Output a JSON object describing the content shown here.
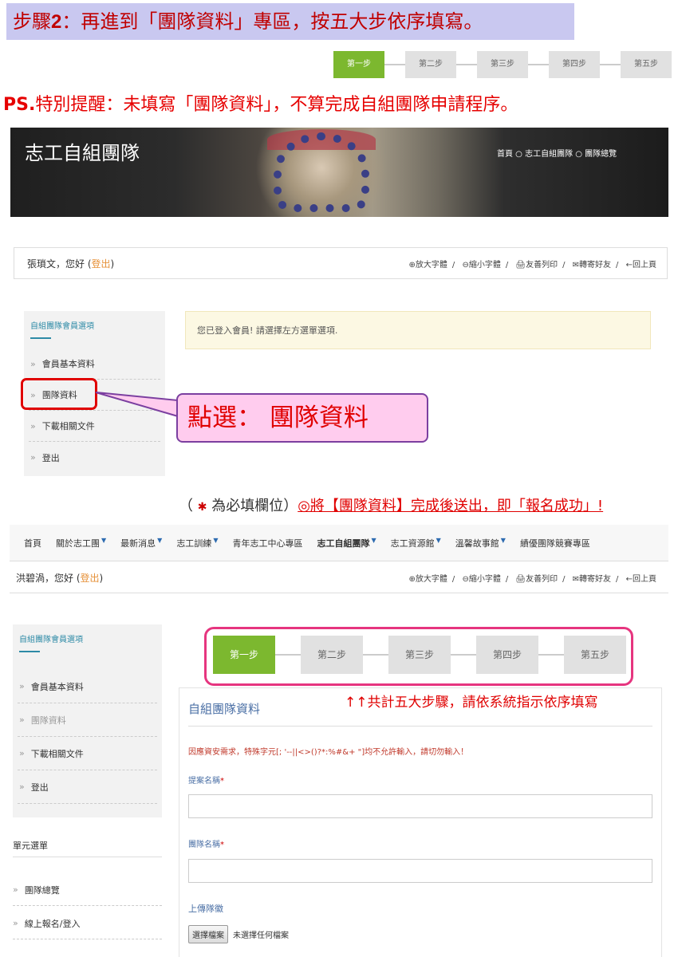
{
  "banner": {
    "prefix": "步驟",
    "num": "2",
    "rest": "：再進到「團隊資料」專區，按五大步依序填寫。"
  },
  "top_steps": [
    "第一步",
    "第二步",
    "第三步",
    "第四步",
    "第五步"
  ],
  "ps_note": {
    "prefix": "PS.",
    "rest": "特別提醒：未填寫「團隊資料」，不算完成自組團隊申請程序。"
  },
  "hero": {
    "title": "志工自組團隊",
    "breadcrumb": "首頁 ○ 志工自組團隊 ○ 團隊總覽"
  },
  "userbar1": {
    "greeting": "張瑣文，您好 (",
    "logout": "登出",
    "close": ")"
  },
  "tools": {
    "enlarge": "⊕放大字體",
    "shrink": "⊖縮小字體",
    "print": "🖨友善列印",
    "mail": "✉轉寄好友",
    "back": "←回上頁",
    "sep": "/"
  },
  "sidebar1": {
    "title": "自組團隊會員選項",
    "items": [
      "會員基本資料",
      "團隊資料",
      "下載相關文件",
      "登出"
    ]
  },
  "alert": "您已登入會員! 請選擇左方選單選項.",
  "callout": "點選： 團隊資料",
  "req_note": {
    "open": "（ ",
    "star": "✱",
    "text": " 為必填欄位）",
    "red": "◎將【團隊資料】完成後送出，即「報名成功」!"
  },
  "navbar": [
    {
      "label": "首頁",
      "caret": false
    },
    {
      "label": "關於志工團",
      "caret": true
    },
    {
      "label": "最新消息",
      "caret": true
    },
    {
      "label": "志工訓練",
      "caret": true
    },
    {
      "label": "青年志工中心專區",
      "caret": false
    },
    {
      "label": "志工自組團隊",
      "caret": true,
      "bold": true
    },
    {
      "label": "志工資源館",
      "caret": true
    },
    {
      "label": "溫馨故事館",
      "caret": true
    },
    {
      "label": "績優團隊競賽專區",
      "caret": false
    }
  ],
  "userbar2": {
    "greeting": "洪碧渦，您好 (",
    "logout": "登出",
    "close": ")"
  },
  "sidebar2": {
    "title": "自組團隊會員選項",
    "items": [
      "會員基本資料",
      "團隊資料",
      "下載相關文件",
      "登出"
    ]
  },
  "unit_menu": {
    "title": "單元選單",
    "items": [
      "團隊總覽",
      "線上報名/登入"
    ]
  },
  "big_steps": [
    "第一步",
    "第二步",
    "第三步",
    "第四步",
    "第五步"
  ],
  "steps_note": "↑↑共計五大步驟，請依系統指示依序填寫",
  "form": {
    "title": "自組團隊資料",
    "warning": "因應資安需求，特殊字元[;  '--||<>()?*:%#&+  \"]均不允許輸入，請切勿輸入！",
    "proposal_label": "提案名稱",
    "team_label": "團隊名稱",
    "upload_label": "上傳隊徽",
    "file_button": "選擇檔案",
    "file_status": "未選擇任何檔案"
  },
  "colors": {
    "active_step": "#7cb82f",
    "inactive_step": "#e1e1e1",
    "accent_red": "#e00000",
    "frame_pink": "#e6357f",
    "link_blue": "#2d8aa6"
  }
}
